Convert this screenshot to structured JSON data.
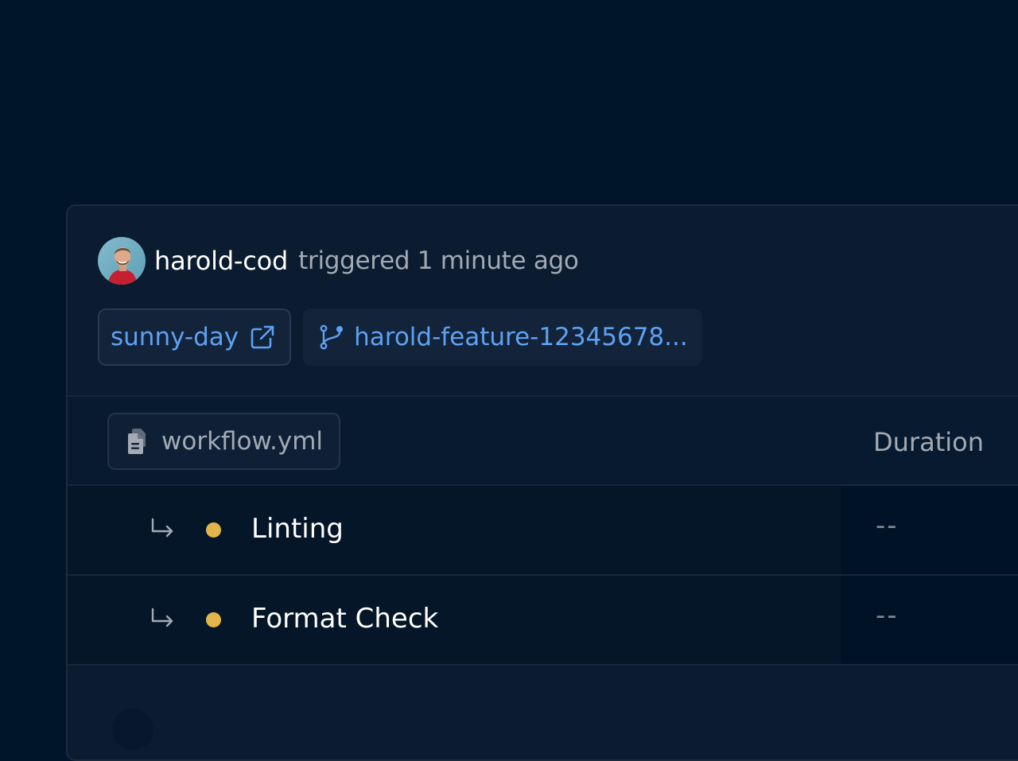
{
  "run": {
    "username": "harold-cod",
    "trigger_text": "triggered 1 minute ago"
  },
  "repo_chip": {
    "label": "sunny-day",
    "icon": "external-link-icon"
  },
  "branch_chip": {
    "label": "harold-feature-12345678...",
    "icon": "git-branch-icon"
  },
  "workflow": {
    "file_label": "workflow.yml",
    "file_icon": "document-icon",
    "duration_header": "Duration"
  },
  "jobs": [
    {
      "name": "Linting",
      "status": "pending",
      "status_color": "#e3b64c",
      "duration": "--"
    },
    {
      "name": "Format Check",
      "status": "pending",
      "status_color": "#e3b64c",
      "duration": "--"
    }
  ],
  "colors": {
    "background": "#00152a",
    "card": "#0b1b30",
    "link": "#5ea1f2",
    "muted_text": "#a3aab4",
    "pending": "#e3b64c"
  }
}
